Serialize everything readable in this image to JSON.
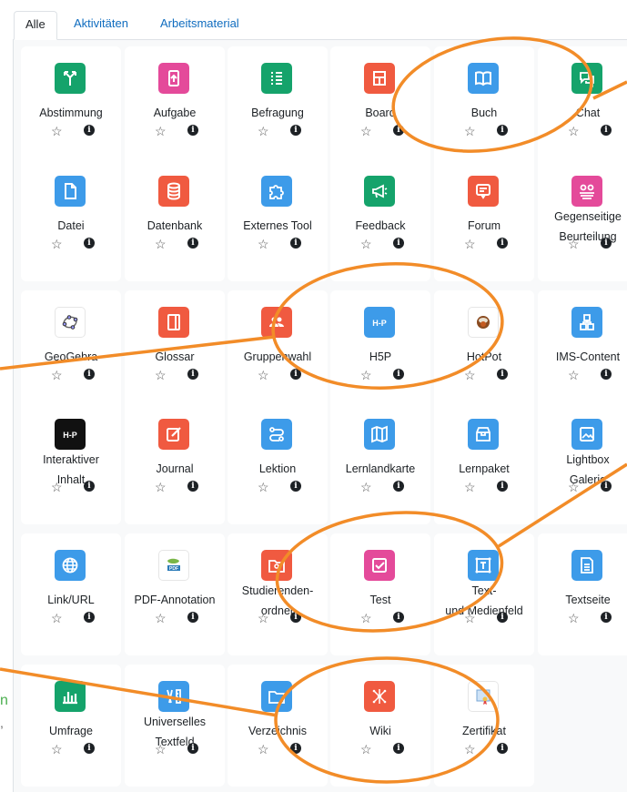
{
  "tabs": [
    "Alle",
    "Aktivitäten",
    "Arbeitsmaterial"
  ],
  "accent": "#f28c28",
  "tiles": [
    {
      "label": "Abstimmung",
      "icon": "choice-icon",
      "color": "green"
    },
    {
      "label": "Aufgabe",
      "icon": "assignment-icon",
      "color": "purple"
    },
    {
      "label": "Befragung",
      "icon": "survey-icon",
      "color": "green"
    },
    {
      "label": "Board",
      "icon": "board-icon",
      "color": "red"
    },
    {
      "label": "Buch",
      "icon": "book-icon",
      "color": "blue"
    },
    {
      "label": "Chat",
      "icon": "chat-icon",
      "color": "green"
    },
    {
      "label": "Datei",
      "icon": "file-icon",
      "color": "blue"
    },
    {
      "label": "Datenbank",
      "icon": "database-icon",
      "color": "red"
    },
    {
      "label": "Externes Tool",
      "icon": "puzzle-icon",
      "color": "blue"
    },
    {
      "label": "Feedback",
      "icon": "megaphone-icon",
      "color": "green"
    },
    {
      "label": "Forum",
      "icon": "forum-icon",
      "color": "red"
    },
    {
      "label": "Gegenseitige Beurteilung",
      "icon": "workshop-icon",
      "color": "purple"
    },
    {
      "label": "GeoGebra",
      "icon": "geogebra-icon",
      "color": "white"
    },
    {
      "label": "Glossar",
      "icon": "glossary-icon",
      "color": "red"
    },
    {
      "label": "Gruppenwahl",
      "icon": "group-icon",
      "color": "red"
    },
    {
      "label": "H5P",
      "icon": "h5p-icon",
      "color": "blue"
    },
    {
      "label": "HotPot",
      "icon": "hotpot-icon",
      "color": "white"
    },
    {
      "label": "IMS-Content",
      "icon": "ims-icon",
      "color": "blue"
    },
    {
      "label": "Interaktiver Inhalt",
      "icon": "h5p-black-icon",
      "color": "black"
    },
    {
      "label": "Journal",
      "icon": "journal-icon",
      "color": "red"
    },
    {
      "label": "Lektion",
      "icon": "lesson-icon",
      "color": "blue"
    },
    {
      "label": "Lernlandkarte",
      "icon": "map-icon",
      "color": "blue"
    },
    {
      "label": "Lernpaket",
      "icon": "package-icon",
      "color": "blue"
    },
    {
      "label": "Lightbox Galerie",
      "icon": "gallery-icon",
      "color": "blue"
    },
    {
      "label": "Link/URL",
      "icon": "globe-icon",
      "color": "blue"
    },
    {
      "label": "PDF-Annotation",
      "icon": "pdf-icon",
      "color": "white"
    },
    {
      "label": "Studierenden-ordner",
      "lines": [
        "Studierenden-",
        "ordner"
      ],
      "icon": "student-folder-icon",
      "color": "red"
    },
    {
      "label": "Test",
      "icon": "quiz-icon",
      "color": "purple"
    },
    {
      "label": "Text- und Medienfeld",
      "icon": "text-media-icon",
      "color": "blue"
    },
    {
      "label": "Textseite",
      "icon": "page-icon",
      "color": "blue"
    },
    {
      "label": "Umfrage",
      "icon": "chart-icon",
      "color": "green"
    },
    {
      "label": "Universelles Textfeld",
      "icon": "pencil-ruler-icon",
      "color": "blue"
    },
    {
      "label": "Verzeichnis",
      "icon": "folder-icon",
      "color": "blue"
    },
    {
      "label": "Wiki",
      "icon": "wiki-icon",
      "color": "red"
    },
    {
      "label": "Zertifikat",
      "icon": "certificate-icon",
      "color": "white"
    }
  ],
  "side_text_1": "n",
  "side_text_2": ","
}
